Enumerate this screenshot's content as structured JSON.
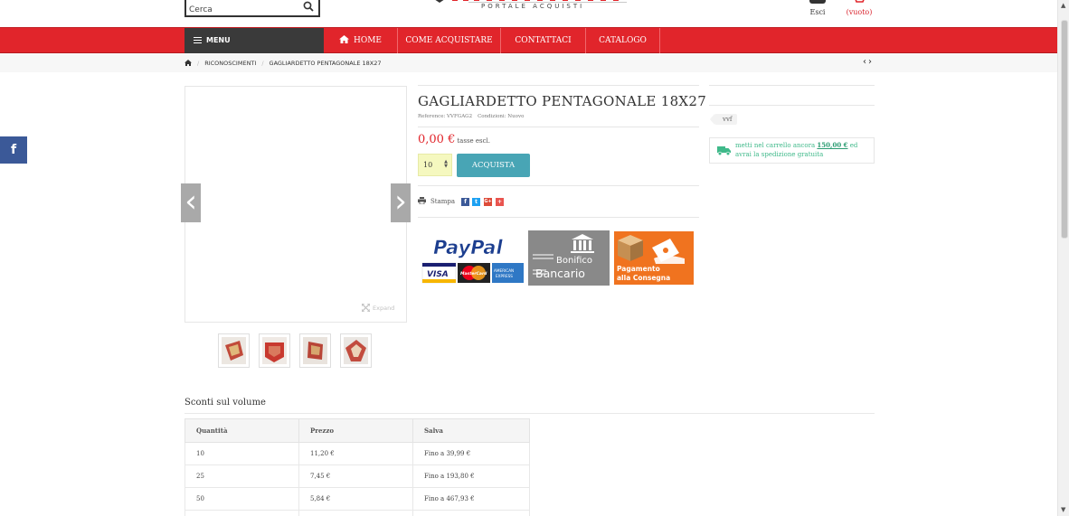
{
  "header": {
    "search_placeholder": "Cerca",
    "logo_subtitle": "PORTALE ACQUISTI",
    "user_label": "Esci",
    "cart_label": "(vuoto)"
  },
  "nav": {
    "menu_label": "MENU",
    "items": [
      "HOME",
      "COME ACQUISTARE",
      "CONTATTACI",
      "CATALOGO"
    ]
  },
  "breadcrumb": {
    "items": [
      "RICONOSCIMENTI",
      "GAGLIARDETTO PENTAGONALE 18X27"
    ]
  },
  "gallery": {
    "expand_label": "Expand",
    "thumbnail_count": 4
  },
  "product": {
    "title": "GAGLIARDETTO PENTAGONALE 18X27",
    "reference": "Reference: VVFGAG2",
    "condition": "Condizioni: Nuovo",
    "price": "0,00 €",
    "tax_note": "tasse escl.",
    "quantity": "10",
    "buy_label": "ACQUISTA",
    "print_label": "Stampa",
    "share": [
      "f",
      "t",
      "G+",
      "+"
    ]
  },
  "payments": {
    "paypal": "PayPal",
    "cards": [
      "VISA",
      "MasterCard",
      "AMERICAN EXPRESS"
    ],
    "bonifico_line1": "Bonifico",
    "bonifico_line2": "Bancario",
    "cod_line1": "Pagamento",
    "cod_line2": "alla Consegna"
  },
  "sidebar": {
    "tag": "vvf",
    "shipping_text_before": "metti nel carrello ancora ",
    "shipping_amount": "150,00 €",
    "shipping_text_after": " ed avrai la spedizione gratuita"
  },
  "volume": {
    "title": "Sconti sul volume",
    "headers": [
      "Quantità",
      "Prezzo",
      "Salva"
    ],
    "rows": [
      [
        "10",
        "11,20 €",
        "Fino a 39,99 €"
      ],
      [
        "25",
        "7,45 €",
        "Fino a 193,80 €"
      ],
      [
        "50",
        "5,84 €",
        "Fino a 467,93 €"
      ]
    ]
  },
  "side_social": "f",
  "colors": {
    "brand_red": "#e1252b",
    "menu_dark": "#3a3a3a",
    "buy_button": "#48a5b5",
    "facebook": "#3b5998",
    "shipping_green": "#3fb98a"
  }
}
